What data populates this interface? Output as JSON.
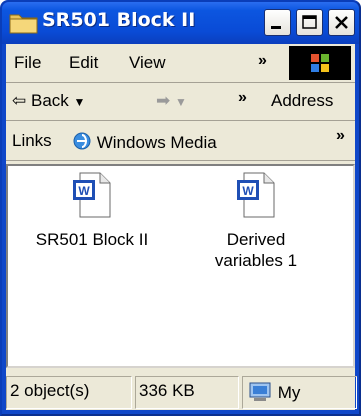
{
  "window": {
    "title": "SR501 Block II"
  },
  "menu": {
    "file": "File",
    "edit": "Edit",
    "view": "View",
    "more": "»"
  },
  "toolbar": {
    "back": "Back",
    "forward_arrow": "➡",
    "more": "»",
    "address": "Address"
  },
  "links": {
    "label": "Links",
    "item": "Windows Media",
    "more": "»"
  },
  "files": [
    {
      "name": "SR501 Block II",
      "icon": "word-document-icon"
    },
    {
      "name": "Derived\nvariables 1",
      "icon": "word-document-icon"
    }
  ],
  "status": {
    "objects": "2 object(s)",
    "size": "336 KB",
    "location": "My"
  },
  "colors": {
    "titlebar": "#0a4bd6",
    "chrome": "#ece9d8",
    "word_blue": "#1f4fb5"
  }
}
